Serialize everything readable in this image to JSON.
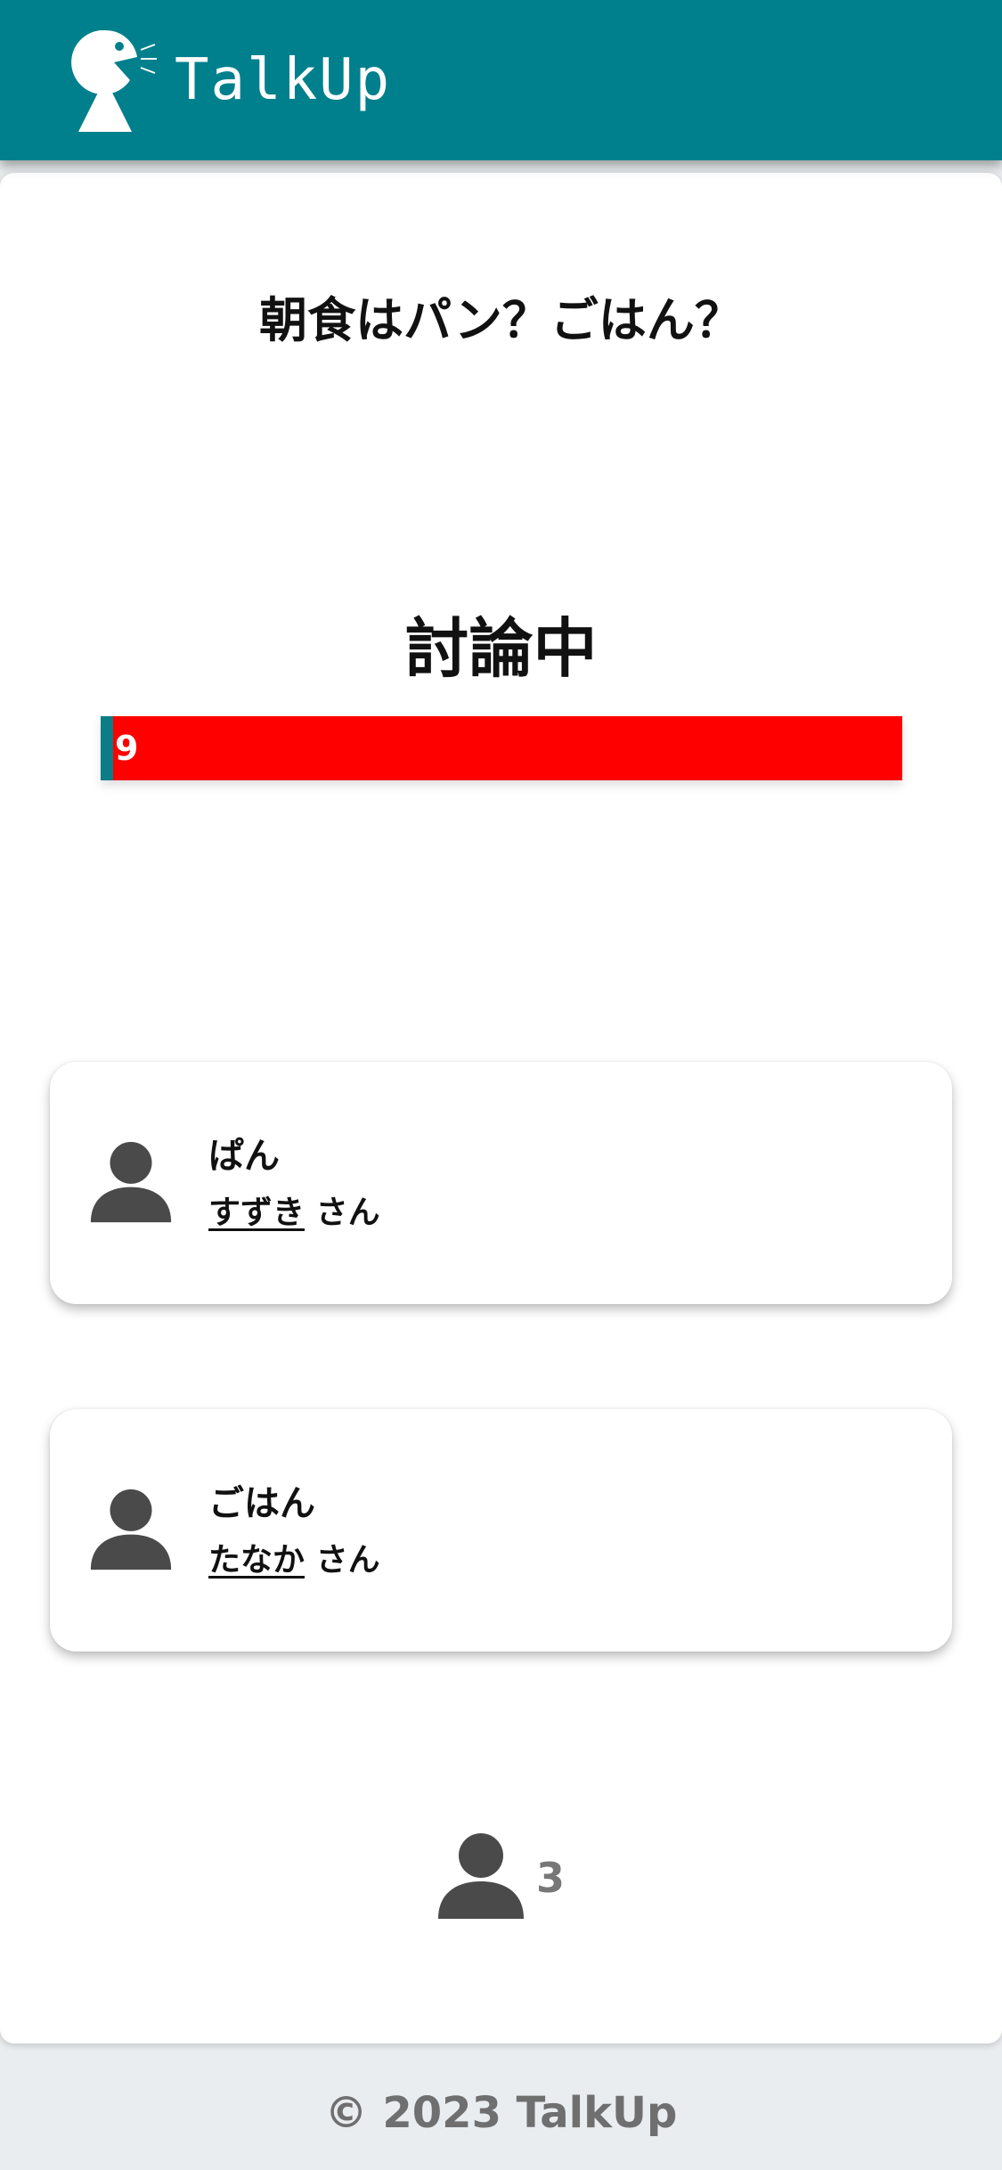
{
  "header": {
    "brand": "TalkUp",
    "logo_icon": "speaking-person-icon",
    "background_color": "#00808c"
  },
  "topic": {
    "title": "朝食はパン？ごはん？"
  },
  "status": {
    "label": "討論中",
    "timer_value": "9",
    "timer_elapsed_fraction": 0.015,
    "timer_bar_color": "#ff0000",
    "timer_fill_color": "#0a7d87"
  },
  "speakers": [
    {
      "side": "ぱん",
      "name": "すずき",
      "suffix": "さん",
      "icon": "person-icon"
    },
    {
      "side": "ごはん",
      "name": "たなか",
      "suffix": "さん",
      "icon": "person-icon"
    }
  ],
  "participants": {
    "count": "3",
    "icon": "person-icon"
  },
  "footer": {
    "copyright": "© 2023 TalkUp"
  }
}
